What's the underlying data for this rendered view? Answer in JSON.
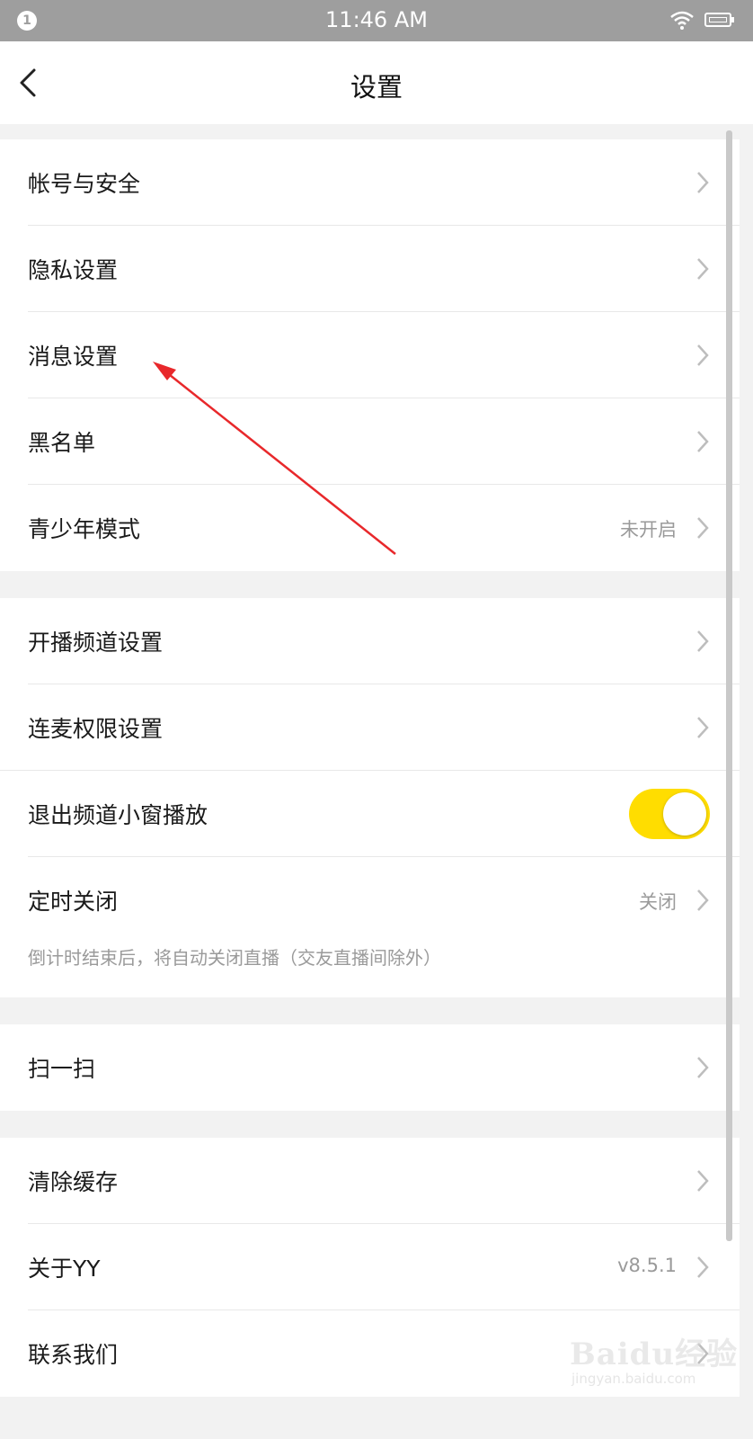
{
  "status_bar": {
    "notification_count": "1",
    "time": "11:46 AM",
    "icons": [
      "wifi-icon",
      "battery-icon"
    ]
  },
  "header": {
    "title": "设置",
    "back_icon": "chevron-left-icon"
  },
  "sections": [
    {
      "items": [
        {
          "label": "帐号与安全",
          "value": ""
        },
        {
          "label": "隐私设置",
          "value": ""
        },
        {
          "label": "消息设置",
          "value": ""
        },
        {
          "label": "黑名单",
          "value": ""
        },
        {
          "label": "青少年模式",
          "value": "未开启"
        }
      ]
    },
    {
      "items": [
        {
          "label": "开播频道设置",
          "value": ""
        },
        {
          "label": "连麦权限设置",
          "value": ""
        },
        {
          "label": "退出频道小窗播放",
          "toggle_on": true
        },
        {
          "label": "定时关闭",
          "value": "关闭"
        }
      ],
      "hint": "倒计时结束后，将自动关闭直播（交友直播间除外）"
    },
    {
      "items": [
        {
          "label": "扫一扫",
          "value": ""
        }
      ]
    },
    {
      "items": [
        {
          "label": "清除缓存",
          "value": ""
        },
        {
          "label": "关于YY",
          "value": "v8.5.1"
        },
        {
          "label": "联系我们",
          "value": ""
        }
      ]
    }
  ],
  "watermark": {
    "brand": "Baidu经验",
    "url": "jingyan.baidu.com"
  },
  "colors": {
    "accent_toggle": "#ffdd00",
    "annotation_arrow": "#e8282b",
    "status_bar": "#9e9e9e"
  }
}
